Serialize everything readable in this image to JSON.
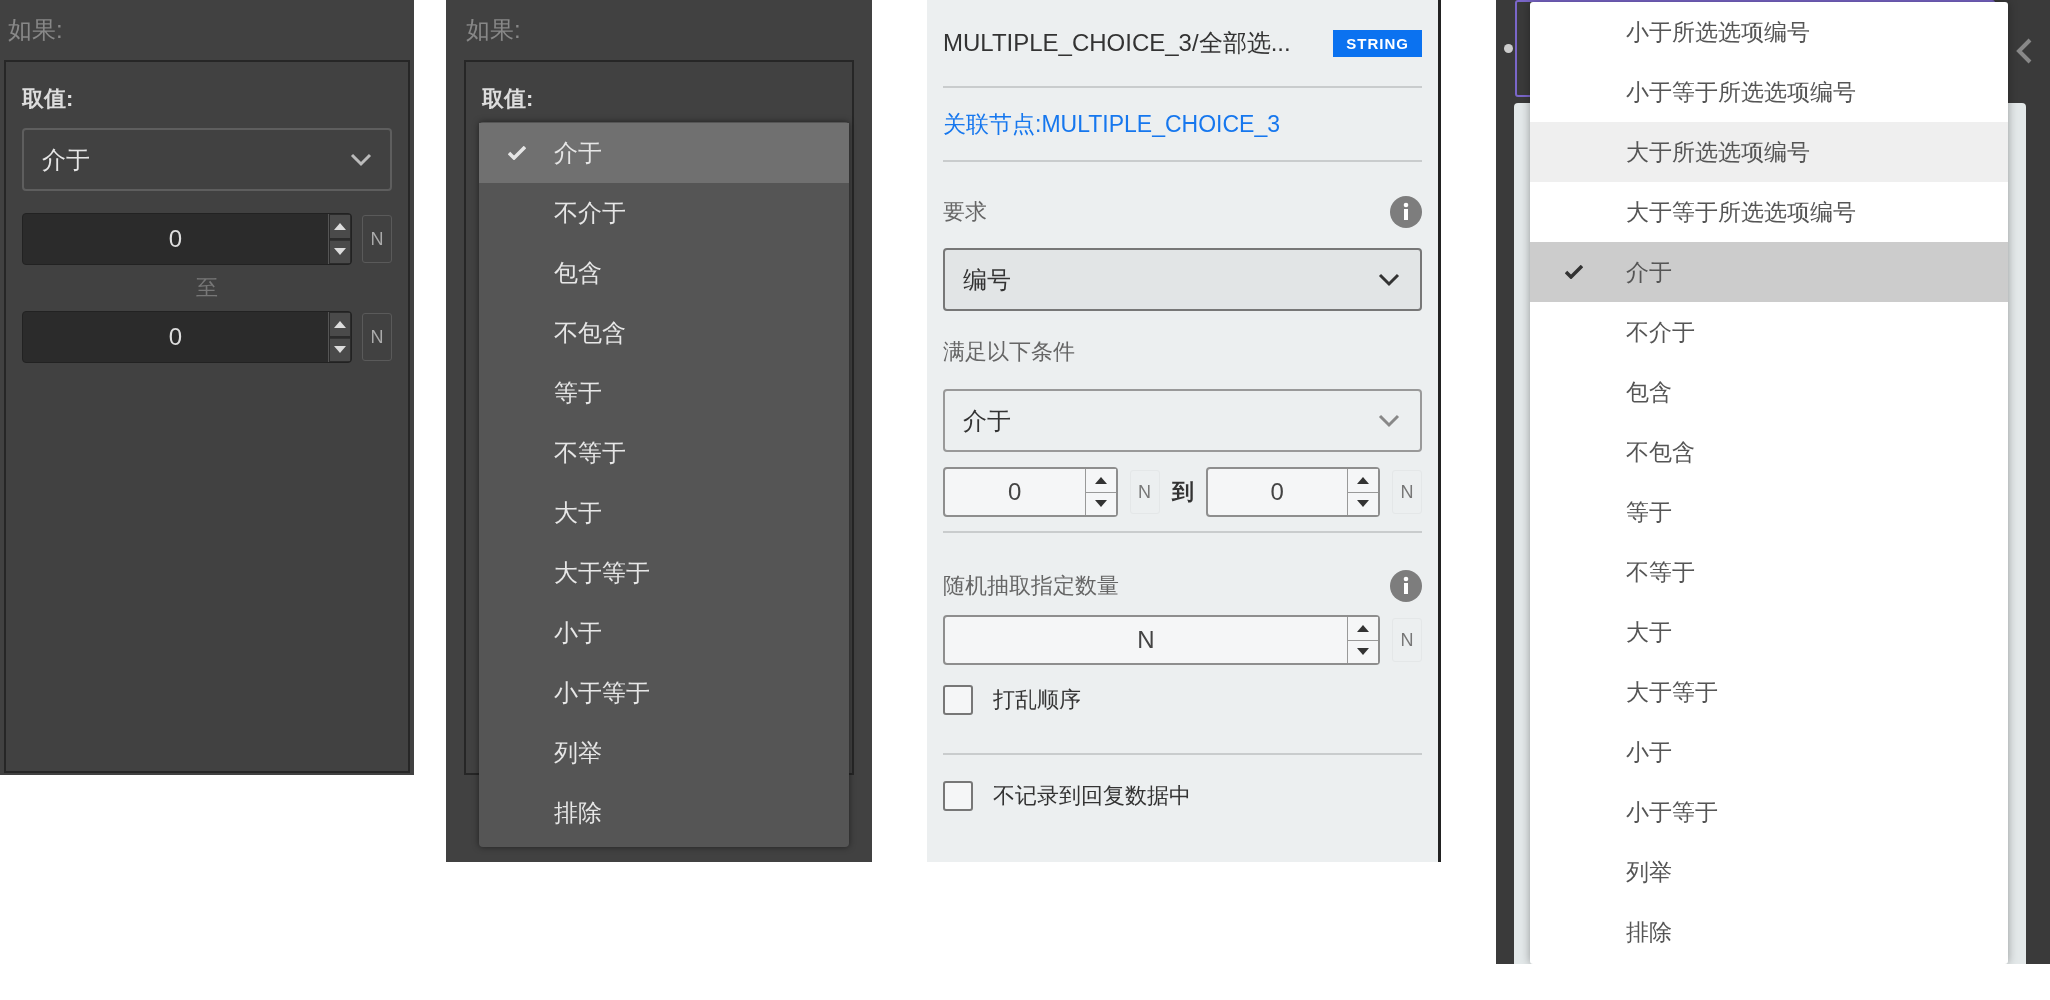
{
  "condition_panel": {
    "section_label": "如果:",
    "field_label": "取值:",
    "operator": {
      "value": "介于"
    },
    "from": {
      "value": "0",
      "unit": "N"
    },
    "separator": "至",
    "to": {
      "value": "0",
      "unit": "N"
    }
  },
  "condition_menu_panel": {
    "section_label": "如果:",
    "field_label": "取值:",
    "menu": [
      {
        "label": "介于",
        "selected": true
      },
      {
        "label": "不介于",
        "selected": false
      },
      {
        "label": "包含",
        "selected": false
      },
      {
        "label": "不包含",
        "selected": false
      },
      {
        "label": "等于",
        "selected": false
      },
      {
        "label": "不等于",
        "selected": false
      },
      {
        "label": "大于",
        "selected": false
      },
      {
        "label": "大于等于",
        "selected": false
      },
      {
        "label": "小于",
        "selected": false
      },
      {
        "label": "小于等于",
        "selected": false
      },
      {
        "label": "列举",
        "selected": false
      },
      {
        "label": "排除",
        "selected": false
      }
    ]
  },
  "property_panel": {
    "title": "MULTIPLE_CHOICE_3/全部选...",
    "type_badge": "STRING",
    "linked_node": "关联节点:MULTIPLE_CHOICE_3",
    "requirement": {
      "label": "要求",
      "value": "编号"
    },
    "condition": {
      "label": "满足以下条件",
      "operator": "介于",
      "from": {
        "value": "0",
        "unit": "N"
      },
      "separator": "到",
      "to": {
        "value": "0",
        "unit": "N"
      }
    },
    "random_sample": {
      "label": "随机抽取指定数量",
      "value": "N",
      "unit": "N"
    },
    "options": [
      {
        "label": "打乱顺序",
        "checked": false
      },
      {
        "label": "不记录到回复数据中",
        "checked": false
      }
    ]
  },
  "operator_menu": {
    "items": [
      {
        "label": "小于所选选项编号",
        "selected": false,
        "highlighted": false
      },
      {
        "label": "小于等于所选选项编号",
        "selected": false,
        "highlighted": false
      },
      {
        "label": "大于所选选项编号",
        "selected": false,
        "highlighted": true
      },
      {
        "label": "大于等于所选选项编号",
        "selected": false,
        "highlighted": false
      },
      {
        "label": "介于",
        "selected": true,
        "highlighted": false
      },
      {
        "label": "不介于",
        "selected": false,
        "highlighted": false
      },
      {
        "label": "包含",
        "selected": false,
        "highlighted": false
      },
      {
        "label": "不包含",
        "selected": false,
        "highlighted": false
      },
      {
        "label": "等于",
        "selected": false,
        "highlighted": false
      },
      {
        "label": "不等于",
        "selected": false,
        "highlighted": false
      },
      {
        "label": "大于",
        "selected": false,
        "highlighted": false
      },
      {
        "label": "大于等于",
        "selected": false,
        "highlighted": false
      },
      {
        "label": "小于",
        "selected": false,
        "highlighted": false
      },
      {
        "label": "小于等于",
        "selected": false,
        "highlighted": false
      },
      {
        "label": "列举",
        "selected": false,
        "highlighted": false
      },
      {
        "label": "排除",
        "selected": false,
        "highlighted": false
      }
    ]
  }
}
